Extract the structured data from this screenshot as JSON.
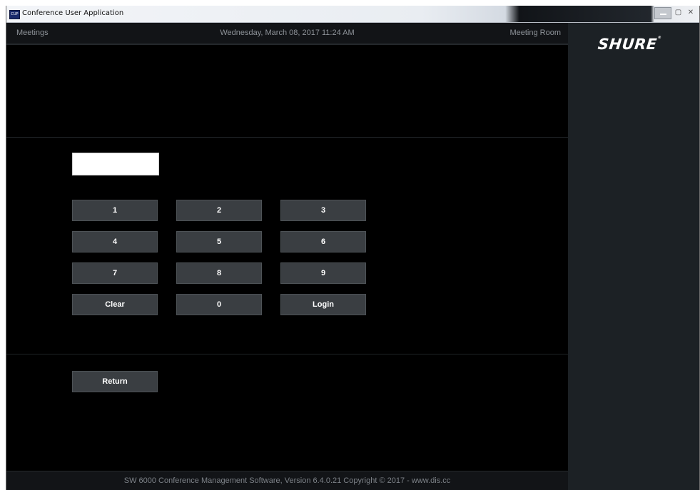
{
  "window": {
    "title": "Conference User Application",
    "icon_text": "CUP",
    "controls": {
      "minimize": "–",
      "maximize": "▢",
      "close": "✕"
    }
  },
  "topbar": {
    "left": "Meetings",
    "center": "Wednesday, March 08, 2017 11:24 AM",
    "right": "Meeting Room"
  },
  "login": {
    "pin_value": "",
    "keypad": {
      "k1": "1",
      "k2": "2",
      "k3": "3",
      "k4": "4",
      "k5": "5",
      "k6": "6",
      "k7": "7",
      "k8": "8",
      "k9": "9",
      "clear": "Clear",
      "k0": "0",
      "login": "Login"
    },
    "return_label": "Return"
  },
  "footer": {
    "text": "SW 6000 Conference Management Software, Version 6.4.0.21    Copyright © 2017 - www.dis.cc"
  },
  "sidebar": {
    "logo_text": "SHURE",
    "logo_mark": "®"
  },
  "colors": {
    "background": "#000000",
    "panel": "#121417",
    "sidebar": "#1c2125",
    "button": "#3a3e42",
    "text_muted": "#8e9399"
  }
}
